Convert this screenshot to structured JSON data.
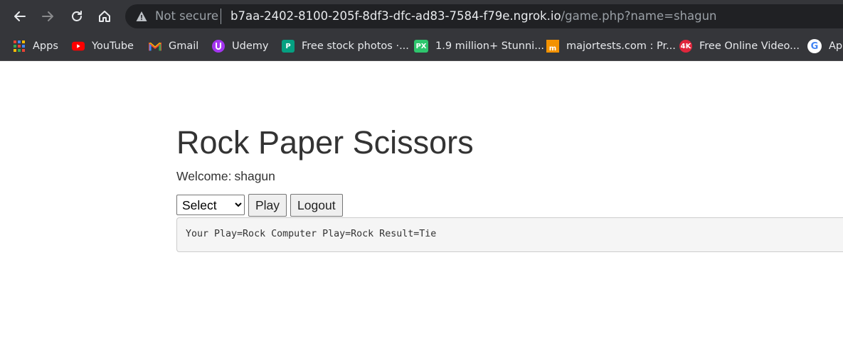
{
  "browser": {
    "security_label": "Not secure",
    "url_host": "b7aa-2402-8100-205f-8df3-dfc-ad83-7584-f79e.ngrok.io",
    "url_path": "/game.php?name=shagun"
  },
  "bookmarks": [
    {
      "label": "Apps",
      "icon": "apps-grid-icon"
    },
    {
      "label": "YouTube",
      "icon": "youtube-icon"
    },
    {
      "label": "Gmail",
      "icon": "gmail-icon"
    },
    {
      "label": "Udemy",
      "icon": "udemy-icon"
    },
    {
      "label": "Free stock photos ·...",
      "icon": "pexels-icon"
    },
    {
      "label": "1.9 million+ Stunni...",
      "icon": "pixabay-icon"
    },
    {
      "label": "majortests.com : Pr...",
      "icon": "majortests-icon"
    },
    {
      "label": "Free Online Video...",
      "icon": "4k-download-icon"
    },
    {
      "label": "App",
      "icon": "google-icon"
    }
  ],
  "page": {
    "title": "Rock Paper Scissors",
    "welcome_label": "Welcome:",
    "username": "shagun",
    "select_value": "Select",
    "play_button": "Play",
    "logout_button": "Logout",
    "result_text": "Your Play=Rock Computer Play=Rock Result=Tie"
  },
  "colors": {
    "browser_chrome": "#35363a",
    "omnibox": "#202124",
    "page_text": "#333333",
    "result_bg": "#f5f5f5"
  }
}
